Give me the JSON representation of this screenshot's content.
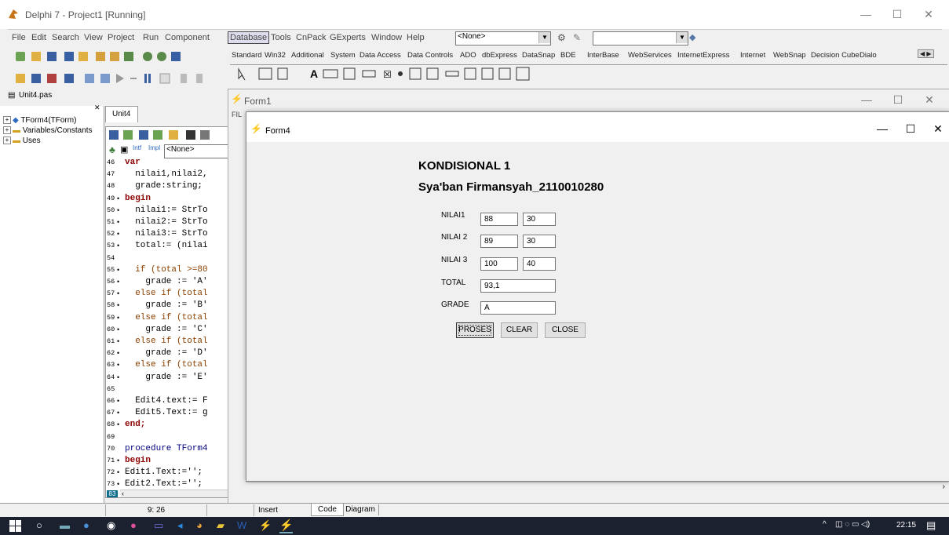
{
  "ide": {
    "title": "Delphi 7 - Project1 [Running]",
    "menu": [
      "File",
      "Edit",
      "Search",
      "View",
      "Project",
      "Run",
      "Component",
      "Database",
      "Tools",
      "CnPack",
      "GExperts",
      "Window",
      "Help"
    ],
    "combo_none": "<None>",
    "palette_tabs": [
      "Standard",
      "Win32",
      "Additional",
      "System",
      "Data Access",
      "Data Controls",
      "ADO",
      "dbExpress",
      "DataSnap",
      "BDE",
      "InterBase",
      "WebServices",
      "InternetExpress",
      "Internet",
      "WebSnap",
      "Decision Cube",
      "Dialo"
    ]
  },
  "tree": {
    "header": "Unit4.pas",
    "items": [
      "TForm4(TForm)",
      "Variables/Constants",
      "Uses"
    ]
  },
  "editor": {
    "tab": "Unit4",
    "combo": "<None>",
    "lines": [
      {
        "n": "46",
        "dot": false,
        "code": "var"
      },
      {
        "n": "47",
        "dot": false,
        "code": "  nilai1,nilai2,"
      },
      {
        "n": "48",
        "dot": false,
        "code": "  grade:string;"
      },
      {
        "n": "49",
        "dot": true,
        "code": "begin"
      },
      {
        "n": "50",
        "dot": true,
        "code": "  nilai1:= StrTo"
      },
      {
        "n": "51",
        "dot": true,
        "code": "  nilai2:= StrTo"
      },
      {
        "n": "52",
        "dot": true,
        "code": "  nilai3:= StrTo"
      },
      {
        "n": "53",
        "dot": true,
        "code": "  total:= (nilai"
      },
      {
        "n": "54",
        "dot": false,
        "code": ""
      },
      {
        "n": "55",
        "dot": true,
        "code": "  if (total >=80"
      },
      {
        "n": "56",
        "dot": true,
        "code": "    grade := 'A'"
      },
      {
        "n": "57",
        "dot": true,
        "code": "  else if (total"
      },
      {
        "n": "58",
        "dot": true,
        "code": "    grade := 'B'"
      },
      {
        "n": "59",
        "dot": true,
        "code": "  else if (total"
      },
      {
        "n": "60",
        "dot": true,
        "code": "    grade := 'C'"
      },
      {
        "n": "61",
        "dot": true,
        "code": "  else if (total"
      },
      {
        "n": "62",
        "dot": true,
        "code": "    grade := 'D'"
      },
      {
        "n": "63",
        "dot": true,
        "code": "  else if (total"
      },
      {
        "n": "64",
        "dot": true,
        "code": "    grade := 'E'"
      },
      {
        "n": "65",
        "dot": false,
        "code": ""
      },
      {
        "n": "66",
        "dot": true,
        "code": "  Edit4.text:= F"
      },
      {
        "n": "67",
        "dot": true,
        "code": "  Edit5.Text:= g"
      },
      {
        "n": "68",
        "dot": true,
        "code": "end;"
      },
      {
        "n": "69",
        "dot": false,
        "code": ""
      },
      {
        "n": "70",
        "dot": false,
        "code": "procedure TForm4"
      },
      {
        "n": "71",
        "dot": true,
        "code": "begin"
      },
      {
        "n": "72",
        "dot": true,
        "code": "Edit1.Text:='';"
      },
      {
        "n": "73",
        "dot": true,
        "code": "Edit2.Text:='';"
      }
    ],
    "last_line": "83"
  },
  "form1": {
    "title": "Form1",
    "fil": "FIL"
  },
  "form4": {
    "title": "Form4",
    "heading1": "KONDISIONAL 1",
    "heading2": "Sya'ban Firmansyah_2110010280",
    "nilai1_label": "NILAI1",
    "nilai2_label": "NILAI 2",
    "nilai3_label": "NILAI 3",
    "total_label": "TOTAL",
    "grade_label": "GRADE",
    "nilai1_a": "88",
    "nilai1_b": "30",
    "nilai2_a": "89",
    "nilai2_b": "30",
    "nilai3_a": "100",
    "nilai3_b": "40",
    "total": "93,1",
    "grade": "A",
    "btn_proses": "PROSES",
    "btn_clear": "CLEAR",
    "btn_close": "CLOSE"
  },
  "status": {
    "pos": "9: 26",
    "mode": "Insert",
    "tab_code": "Code",
    "tab_diagram": "Diagram"
  },
  "taskbar": {
    "time": "22:15"
  }
}
